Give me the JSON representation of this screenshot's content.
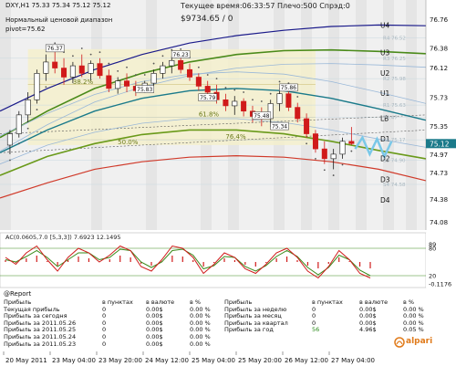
{
  "header": {
    "symbol_line": "DXY,H1  75.33 75.34 75.12 75.12",
    "line2": "Нормальный ценовой диапазон",
    "line3": "pivot=75.62",
    "timeline": "Текущее время:06:33:57 Плечо:500 Спрэд:0",
    "balance": "$9734.65   / 0"
  },
  "colors": {
    "background": "#ffffff",
    "price_bg": "#e8e8e8",
    "shade": "#e0e0e0",
    "u4": "#1a1a8a",
    "u3": "#4a8a1a",
    "u2": "#9ab8d8",
    "lb": "#1a7a8a",
    "d2": "#6a9a1a",
    "d3": "#d03a2a",
    "bull": "#1a1a1a",
    "bear": "#d01a1a",
    "osc_fast": "#d01a1a",
    "osc_slow": "#3a8a1a",
    "osc_hist": "#d01a1a",
    "current_price_bg": "#1a7a8a",
    "alpari_orange": "#e07a1a"
  },
  "chart_data": [
    {
      "type": "candlestick",
      "symbol": "DXY",
      "timeframe": "H1",
      "y_ticks": [
        "76.76",
        "76.38",
        "76.12",
        "75.73",
        "75.35",
        "74.97",
        "74.73",
        "74.38",
        "74.08"
      ],
      "current_price": "75.12",
      "levels": [
        {
          "label": "U4",
          "value": 76.68
        },
        {
          "label": "U3",
          "value": 76.32
        },
        {
          "label": "U2",
          "value": 76.05
        },
        {
          "label": "U1",
          "value": 75.78
        },
        {
          "label": "LB",
          "value": 75.45
        },
        {
          "label": "D1",
          "value": 75.18
        },
        {
          "label": "D2",
          "value": 74.92
        },
        {
          "label": "D3",
          "value": 74.64
        },
        {
          "label": "D4",
          "value": 74.37
        }
      ],
      "faint_level_labels": [
        {
          "label": "R4",
          "text": "R4 76.52",
          "value": 76.52
        },
        {
          "label": "R3",
          "text": "R3 76.25",
          "value": 76.25
        },
        {
          "label": "R2",
          "text": "R2 75.98",
          "value": 75.98
        },
        {
          "label": "R1",
          "text": "R1 75.63",
          "value": 75.63
        },
        {
          "label": "S1",
          "text": "75.47",
          "value": 75.47
        },
        {
          "label": "S2",
          "text": "S2 75.17",
          "value": 75.17
        },
        {
          "label": "S3",
          "text": "S3 74.90",
          "value": 74.9
        },
        {
          "label": "S4",
          "text": "S4 74.58",
          "value": 74.58
        }
      ],
      "price_labels": [
        {
          "text": "76.37",
          "x_index": 5,
          "value": 76.37
        },
        {
          "text": "76.23",
          "x_index": 19,
          "value": 76.29
        },
        {
          "text": "75.83",
          "x_index": 15,
          "value": 75.83
        },
        {
          "text": "75.79",
          "x_index": 22,
          "value": 75.72
        },
        {
          "text": "75.86",
          "x_index": 31,
          "value": 75.85
        },
        {
          "text": "75.48",
          "x_index": 28,
          "value": 75.48
        },
        {
          "text": "75.34",
          "x_index": 30,
          "value": 75.34
        }
      ],
      "fib_labels": [
        {
          "text": "38.2%",
          "value": 75.9
        },
        {
          "text": "61.8%",
          "value": 75.47
        },
        {
          "text": "76.4%",
          "value": 75.17
        },
        {
          "text": "50.0%",
          "value": 75.1
        }
      ],
      "x_labels": [
        "20 May 2011",
        "23 May 04:00",
        "23 May 20:00",
        "24 May 12:00",
        "25 May 04:00",
        "25 May 20:00",
        "26 May 12:00",
        "27 May 04:00"
      ],
      "candles": [
        {
          "o": 75.1,
          "h": 75.3,
          "l": 74.98,
          "c": 75.25
        },
        {
          "o": 75.25,
          "h": 75.55,
          "l": 75.2,
          "c": 75.5
        },
        {
          "o": 75.5,
          "h": 75.8,
          "l": 75.4,
          "c": 75.7
        },
        {
          "o": 75.7,
          "h": 76.1,
          "l": 75.65,
          "c": 76.05
        },
        {
          "o": 76.05,
          "h": 76.3,
          "l": 75.95,
          "c": 76.2
        },
        {
          "o": 76.2,
          "h": 76.37,
          "l": 76.05,
          "c": 76.12
        },
        {
          "o": 76.12,
          "h": 76.25,
          "l": 75.9,
          "c": 76.0
        },
        {
          "o": 76.0,
          "h": 76.2,
          "l": 75.92,
          "c": 76.15
        },
        {
          "o": 76.15,
          "h": 76.3,
          "l": 76.0,
          "c": 76.05
        },
        {
          "o": 76.05,
          "h": 76.22,
          "l": 75.95,
          "c": 76.18
        },
        {
          "o": 76.18,
          "h": 76.25,
          "l": 75.98,
          "c": 76.02
        },
        {
          "o": 76.02,
          "h": 76.1,
          "l": 75.8,
          "c": 75.85
        },
        {
          "o": 75.85,
          "h": 76.0,
          "l": 75.78,
          "c": 75.95
        },
        {
          "o": 75.95,
          "h": 76.05,
          "l": 75.8,
          "c": 75.88
        },
        {
          "o": 75.88,
          "h": 75.95,
          "l": 75.75,
          "c": 75.82
        },
        {
          "o": 75.82,
          "h": 75.95,
          "l": 75.79,
          "c": 75.92
        },
        {
          "o": 75.92,
          "h": 76.1,
          "l": 75.88,
          "c": 76.05
        },
        {
          "o": 76.05,
          "h": 76.2,
          "l": 75.98,
          "c": 76.15
        },
        {
          "o": 76.15,
          "h": 76.28,
          "l": 76.05,
          "c": 76.22
        },
        {
          "o": 76.22,
          "h": 76.29,
          "l": 76.05,
          "c": 76.1
        },
        {
          "o": 76.1,
          "h": 76.18,
          "l": 75.95,
          "c": 76.0
        },
        {
          "o": 76.0,
          "h": 76.05,
          "l": 75.82,
          "c": 75.88
        },
        {
          "o": 75.88,
          "h": 75.95,
          "l": 75.72,
          "c": 75.8
        },
        {
          "o": 75.8,
          "h": 75.9,
          "l": 75.65,
          "c": 75.7
        },
        {
          "o": 75.7,
          "h": 75.78,
          "l": 75.55,
          "c": 75.62
        },
        {
          "o": 75.62,
          "h": 75.75,
          "l": 75.5,
          "c": 75.68
        },
        {
          "o": 75.68,
          "h": 75.72,
          "l": 75.48,
          "c": 75.55
        },
        {
          "o": 75.55,
          "h": 75.62,
          "l": 75.4,
          "c": 75.48
        },
        {
          "o": 75.48,
          "h": 75.6,
          "l": 75.35,
          "c": 75.45
        },
        {
          "o": 75.45,
          "h": 75.7,
          "l": 75.34,
          "c": 75.65
        },
        {
          "o": 75.65,
          "h": 75.86,
          "l": 75.55,
          "c": 75.78
        },
        {
          "o": 75.78,
          "h": 75.84,
          "l": 75.55,
          "c": 75.6
        },
        {
          "o": 75.6,
          "h": 75.66,
          "l": 75.4,
          "c": 75.45
        },
        {
          "o": 75.45,
          "h": 75.52,
          "l": 75.2,
          "c": 75.25
        },
        {
          "o": 75.25,
          "h": 75.3,
          "l": 75.0,
          "c": 75.05
        },
        {
          "o": 75.05,
          "h": 75.15,
          "l": 74.85,
          "c": 74.92
        },
        {
          "o": 74.92,
          "h": 75.05,
          "l": 74.78,
          "c": 74.98
        },
        {
          "o": 74.98,
          "h": 75.2,
          "l": 74.92,
          "c": 75.15
        },
        {
          "o": 75.15,
          "h": 75.34,
          "l": 75.1,
          "c": 75.12
        }
      ],
      "projection": [
        75.05,
        75.2,
        74.98,
        75.18,
        74.95,
        75.15
      ],
      "u4_curve": [
        75.55,
        75.85,
        76.1,
        76.3,
        76.45,
        76.55,
        76.62,
        76.67,
        76.69,
        76.68
      ],
      "u3_curve": [
        75.2,
        75.55,
        75.85,
        76.05,
        76.2,
        76.3,
        76.35,
        76.36,
        76.34,
        76.31
      ],
      "lb_curve": [
        75.0,
        75.3,
        75.55,
        75.72,
        75.82,
        75.85,
        75.82,
        75.72,
        75.58,
        75.43
      ],
      "d2_curve": [
        74.7,
        74.95,
        75.12,
        75.24,
        75.3,
        75.3,
        75.25,
        75.15,
        75.03,
        74.92
      ],
      "d3_curve": [
        74.4,
        74.6,
        74.78,
        74.88,
        74.94,
        74.96,
        74.94,
        74.88,
        74.78,
        74.63
      ]
    },
    {
      "type": "oscillator",
      "title": "AC(0.0605,7.0 [5,3,3]) 7.6923 12.1495",
      "y_ticks": [
        "89",
        "80",
        "20",
        "-0.1176"
      ],
      "fast": [
        60,
        45,
        70,
        85,
        55,
        30,
        60,
        80,
        70,
        50,
        65,
        85,
        75,
        40,
        30,
        55,
        85,
        80,
        60,
        25,
        45,
        70,
        60,
        35,
        25,
        45,
        70,
        80,
        60,
        30,
        15,
        40,
        75,
        55,
        25,
        15
      ],
      "slow": [
        55,
        50,
        62,
        75,
        60,
        40,
        55,
        70,
        70,
        55,
        60,
        78,
        75,
        50,
        38,
        50,
        75,
        78,
        65,
        35,
        42,
        62,
        60,
        40,
        30,
        42,
        62,
        75,
        62,
        38,
        22,
        38,
        65,
        55,
        32,
        20
      ]
    }
  ],
  "report": {
    "title": "@Report",
    "col_headers_left": [
      "Прибыль",
      "в пунктах",
      "в валюте",
      "в %"
    ],
    "col_headers_right": [
      "Прибыль",
      "в пунктах",
      "в валюте",
      "в %"
    ],
    "rows_left": [
      [
        "Текущая прибыль",
        "0",
        "0.00$",
        "0.00 %"
      ],
      [
        "Прибыль за сегодня",
        "0",
        "0.00$",
        "0.00 %"
      ],
      [
        "Прибыль за 2011.05.26",
        "0",
        "0.00$",
        "0.00 %"
      ],
      [
        "Прибыль за 2011.05.25",
        "0",
        "0.00$",
        "0.00 %"
      ],
      [
        "Прибыль за 2011.05.24",
        "0",
        "0.00$",
        "0.00 %"
      ],
      [
        "Прибыль за 2011.05.23",
        "0",
        "0.00$",
        "0.00 %"
      ]
    ],
    "rows_right": [
      [
        "Прибыль за неделю",
        "0",
        "0.00$",
        "0.00 %"
      ],
      [
        "Прибыль за месяц",
        "0",
        "0.00$",
        "0.00 %"
      ],
      [
        "Прибыль за квартал",
        "0",
        "0.00$",
        "0.00 %"
      ],
      [
        "Прибыль за год",
        "56",
        "4.96$",
        "0.05 %"
      ]
    ],
    "brand": "alpari"
  }
}
